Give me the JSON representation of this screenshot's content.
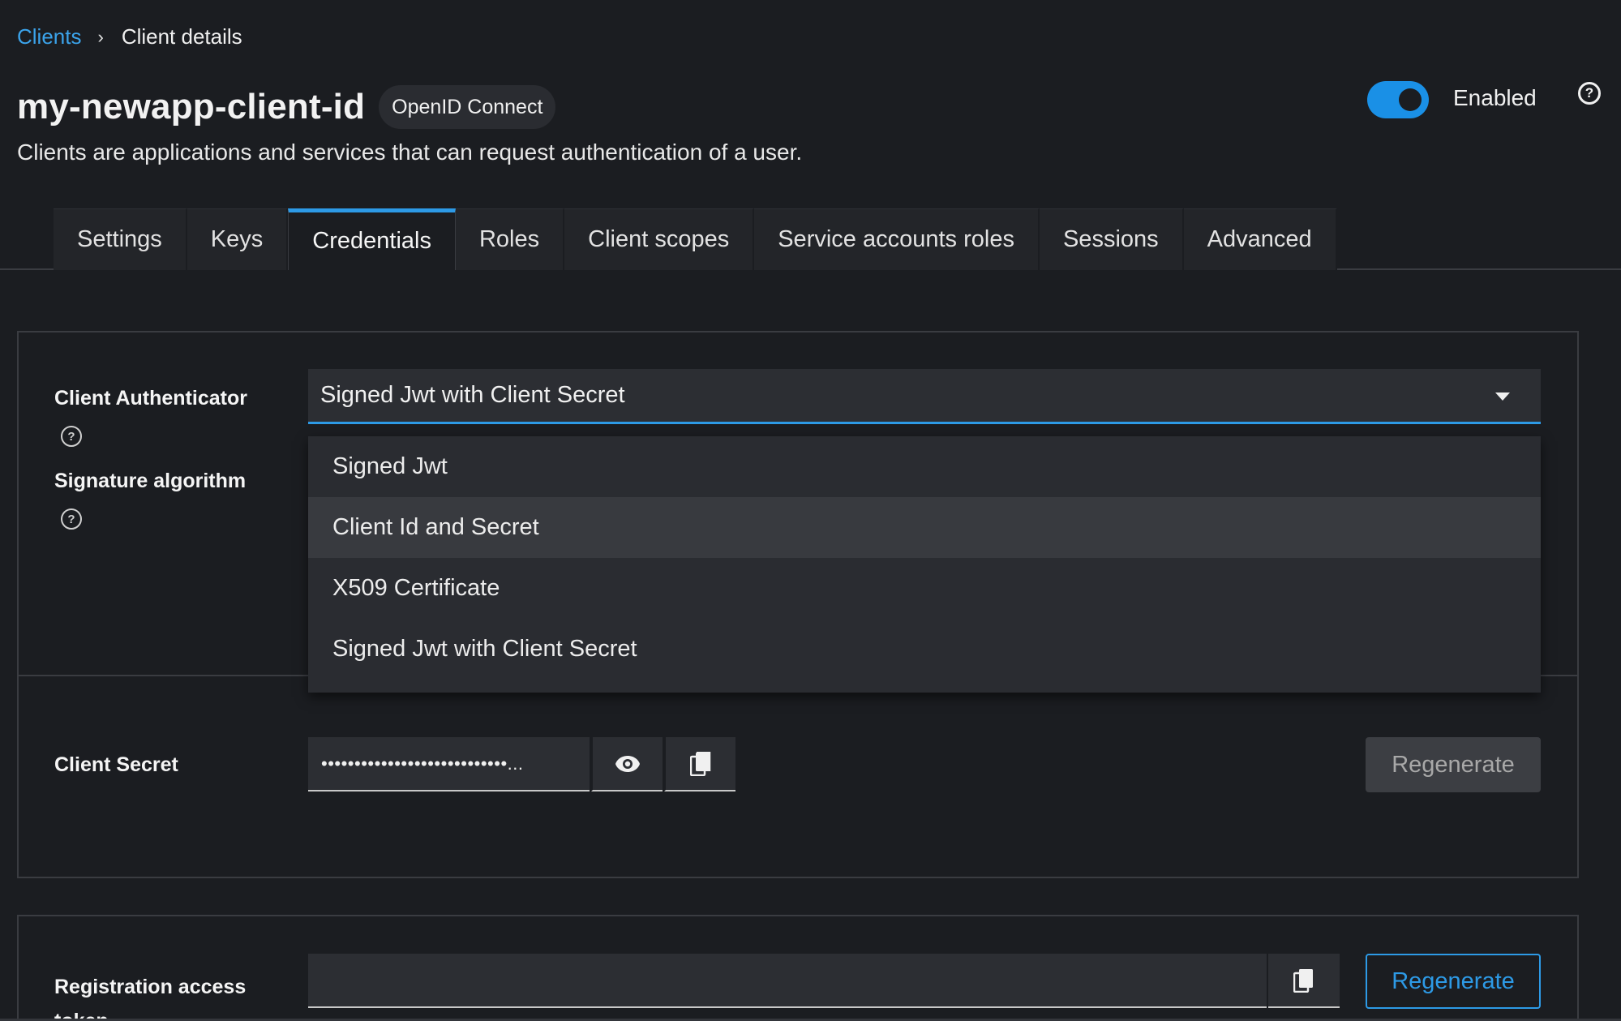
{
  "breadcrumb": {
    "parent": "Clients",
    "separator": "›",
    "current": "Client details"
  },
  "header": {
    "title": "my-newapp-client-id",
    "badge": "OpenID Connect",
    "subtitle": "Clients are applications and services that can request authentication of a user.",
    "enabled_label": "Enabled",
    "enabled": true,
    "help_glyph": "?"
  },
  "tabs": [
    {
      "label": "Settings"
    },
    {
      "label": "Keys"
    },
    {
      "label": "Credentials",
      "active": true
    },
    {
      "label": "Roles"
    },
    {
      "label": "Client scopes"
    },
    {
      "label": "Service accounts roles"
    },
    {
      "label": "Sessions"
    },
    {
      "label": "Advanced"
    }
  ],
  "credentials": {
    "client_authenticator_label": "Client Authenticator",
    "signature_algorithm_label": "Signature algorithm",
    "help_glyph": "?",
    "selected_authenticator": "Signed Jwt with Client Secret",
    "authenticator_options": [
      "Signed Jwt",
      "Client Id and Secret",
      "X509 Certificate",
      "Signed Jwt with Client Secret"
    ],
    "client_secret_label": "Client Secret",
    "client_secret_masked": "••••••••••••••••••••••••••••...",
    "regenerate_label": "Regenerate",
    "registration_token_label": "Registration access token",
    "registration_regenerate_label": "Regenerate"
  },
  "colors": {
    "accent": "#2d9ae6",
    "background": "#1b1d21"
  }
}
